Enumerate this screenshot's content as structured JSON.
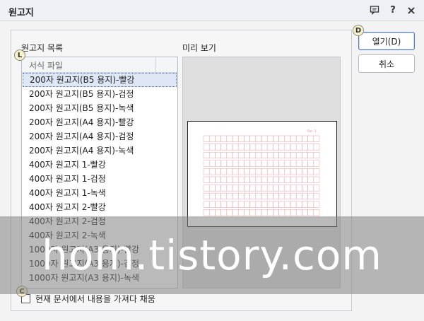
{
  "window": {
    "title": "원고지"
  },
  "titlebar_icons": [
    "chat-icon",
    "help-icon",
    "close-icon"
  ],
  "titlebar_glyphs": {
    "help": "?",
    "close": "×"
  },
  "labels": {
    "list": "원고지 목록",
    "preview": "미리 보기"
  },
  "list": {
    "header": "서식 파일",
    "selected_index": 0,
    "items": [
      "200자 원고지(B5 용지)-빨강",
      "200자 원고지(B5 용지)-검정",
      "200자 원고지(B5 용지)-녹색",
      "200자 원고지(A4 용지)-빨강",
      "200자 원고지(A4 용지)-검정",
      "200자 원고지(A4 용지)-녹색",
      "400자 원고지 1-빨강",
      "400자 원고지 1-검정",
      "400자 원고지 1-녹색",
      "400자 원고지 2-빨강",
      "400자 원고지 2-검정",
      "400자 원고지 2-녹색",
      "1000자 원고지(A3 용지)-빨강",
      "1000자 원고지(A3 용지)-검정",
      "1000자 원고지(A3 용지)-녹색"
    ]
  },
  "preview": {
    "page_label": "No.   1",
    "grid_color": "#e8a0a8"
  },
  "checkbox": {
    "label": "현재 문서에서 내용을 가져다 채움",
    "checked": false
  },
  "buttons": {
    "open": "열기(D)",
    "cancel": "취소"
  },
  "badges": {
    "d": "D",
    "l": "L",
    "c": "C"
  },
  "watermark": "hom.tistory.com"
}
